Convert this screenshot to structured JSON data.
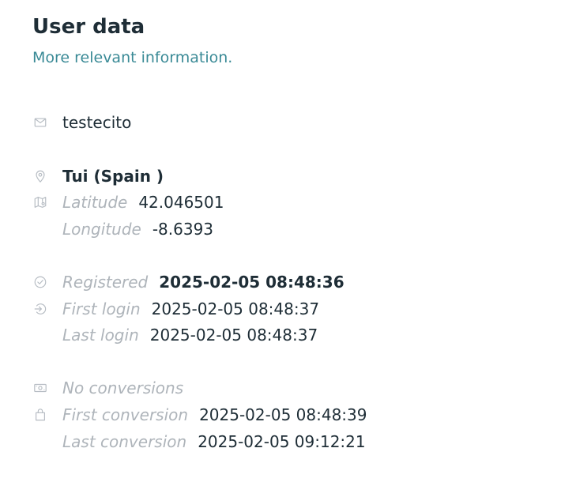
{
  "header": {
    "title": "User data",
    "subtitle": "More relevant information."
  },
  "contact": {
    "icon": "mail-icon",
    "email": "testecito"
  },
  "location": {
    "city_icon": "map-pin-icon",
    "city": "Tui (Spain )",
    "coords_icon": "map-location-icon",
    "latitude_label": "Latitude",
    "latitude": "42.046501",
    "longitude_label": "Longitude",
    "longitude": "-8.6393"
  },
  "activity": {
    "registered_icon": "check-circle-icon",
    "registered_label": "Registered",
    "registered": "2025-02-05 08:48:36",
    "first_login_icon": "login-icon",
    "first_login_label": "First login",
    "first_login": "2025-02-05 08:48:37",
    "last_login_label": "Last login",
    "last_login": "2025-02-05 08:48:37"
  },
  "conversions": {
    "summary_icon": "money-icon",
    "summary": "No conversions",
    "bag_icon": "shopping-bag-icon",
    "first_label": "First conversion",
    "first": "2025-02-05 08:48:39",
    "last_label": "Last conversion",
    "last": "2025-02-05 09:12:21"
  },
  "colors": {
    "title": "#1e2d36",
    "subtitle": "#3a8a96",
    "label": "#aeb4ba",
    "icon": "#b6bcc3"
  }
}
